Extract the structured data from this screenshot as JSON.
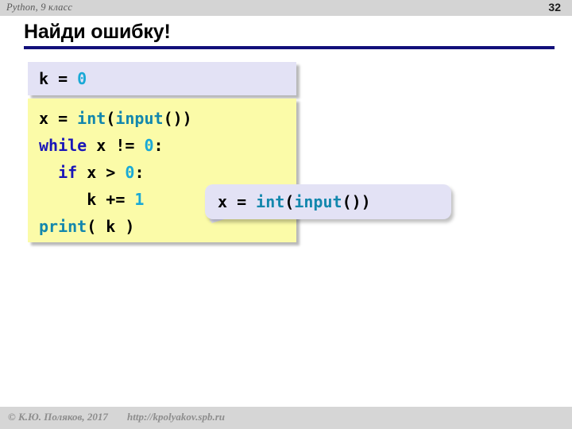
{
  "topbar": {
    "course_label": "Python, 9 класс",
    "page_number": "32",
    "background": "#d4d4d4"
  },
  "slide": {
    "title": "Найди ошибку!",
    "rule_color": "#12107a"
  },
  "code_block_1": {
    "background": "#e3e2f5",
    "lines": [
      {
        "tokens": [
          {
            "t": "k = ",
            "c": "plain"
          },
          {
            "t": "0",
            "c": "num"
          }
        ]
      }
    ]
  },
  "code_block_2": {
    "background": "#fbfba8",
    "lines": [
      {
        "tokens": [
          {
            "t": "x = ",
            "c": "plain"
          },
          {
            "t": "int",
            "c": "fn"
          },
          {
            "t": "(",
            "c": "plain"
          },
          {
            "t": "input",
            "c": "fn"
          },
          {
            "t": "())",
            "c": "plain"
          }
        ]
      },
      {
        "tokens": [
          {
            "t": "while",
            "c": "kw"
          },
          {
            "t": " x != ",
            "c": "plain"
          },
          {
            "t": "0",
            "c": "num"
          },
          {
            "t": ":",
            "c": "plain"
          }
        ]
      },
      {
        "tokens": [
          {
            "t": "  ",
            "c": "plain"
          },
          {
            "t": "if",
            "c": "kw"
          },
          {
            "t": " x > ",
            "c": "plain"
          },
          {
            "t": "0",
            "c": "num"
          },
          {
            "t": ":",
            "c": "plain"
          }
        ]
      },
      {
        "tokens": [
          {
            "t": "     k += ",
            "c": "plain"
          },
          {
            "t": "1",
            "c": "num"
          }
        ]
      },
      {
        "tokens": [
          {
            "t": "print",
            "c": "fn"
          },
          {
            "t": "( k )",
            "c": "plain"
          }
        ]
      }
    ]
  },
  "callout": {
    "background": "#e3e2f5",
    "tokens": [
      {
        "t": "x = ",
        "c": "plain"
      },
      {
        "t": "int",
        "c": "fn"
      },
      {
        "t": "(",
        "c": "plain"
      },
      {
        "t": "input",
        "c": "fn"
      },
      {
        "t": "())",
        "c": "plain"
      }
    ]
  },
  "footer": {
    "copyright": "© К.Ю. Поляков, 2017",
    "url": "http://kpolyakov.spb.ru",
    "background": "#d6d6d6"
  }
}
